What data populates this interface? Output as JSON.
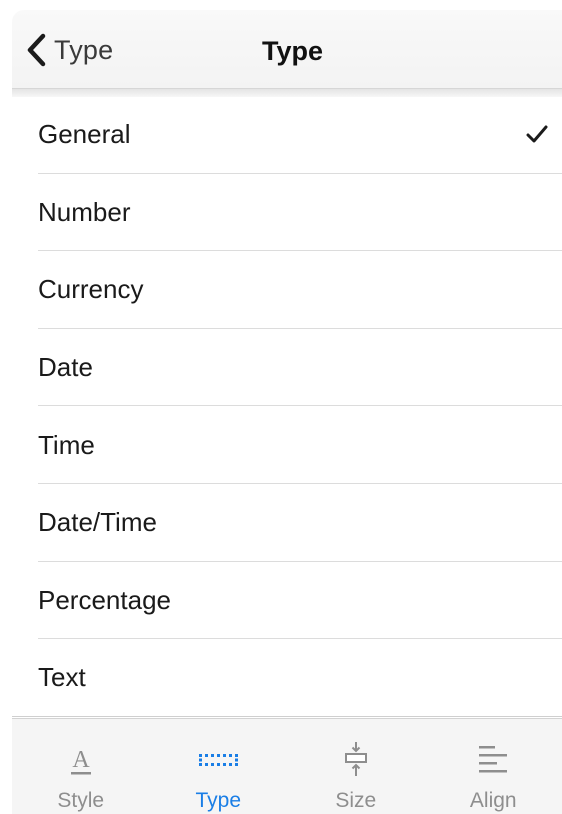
{
  "navbar": {
    "back_label": "Type",
    "title": "Type"
  },
  "list": {
    "items": [
      {
        "label": "General",
        "selected": true
      },
      {
        "label": "Number",
        "selected": false
      },
      {
        "label": "Currency",
        "selected": false
      },
      {
        "label": "Date",
        "selected": false
      },
      {
        "label": "Time",
        "selected": false
      },
      {
        "label": "Date/Time",
        "selected": false
      },
      {
        "label": "Percentage",
        "selected": false
      },
      {
        "label": "Text",
        "selected": false
      }
    ]
  },
  "tabbar": {
    "tabs": [
      {
        "label": "Style",
        "icon": "text-style-icon",
        "active": false
      },
      {
        "label": "Type",
        "icon": "number-format-icon",
        "active": true
      },
      {
        "label": "Size",
        "icon": "cell-size-icon",
        "active": false
      },
      {
        "label": "Align",
        "icon": "align-left-icon",
        "active": false
      }
    ]
  },
  "colors": {
    "accent": "#1a7ee6",
    "inactive": "#8e8e8e"
  }
}
